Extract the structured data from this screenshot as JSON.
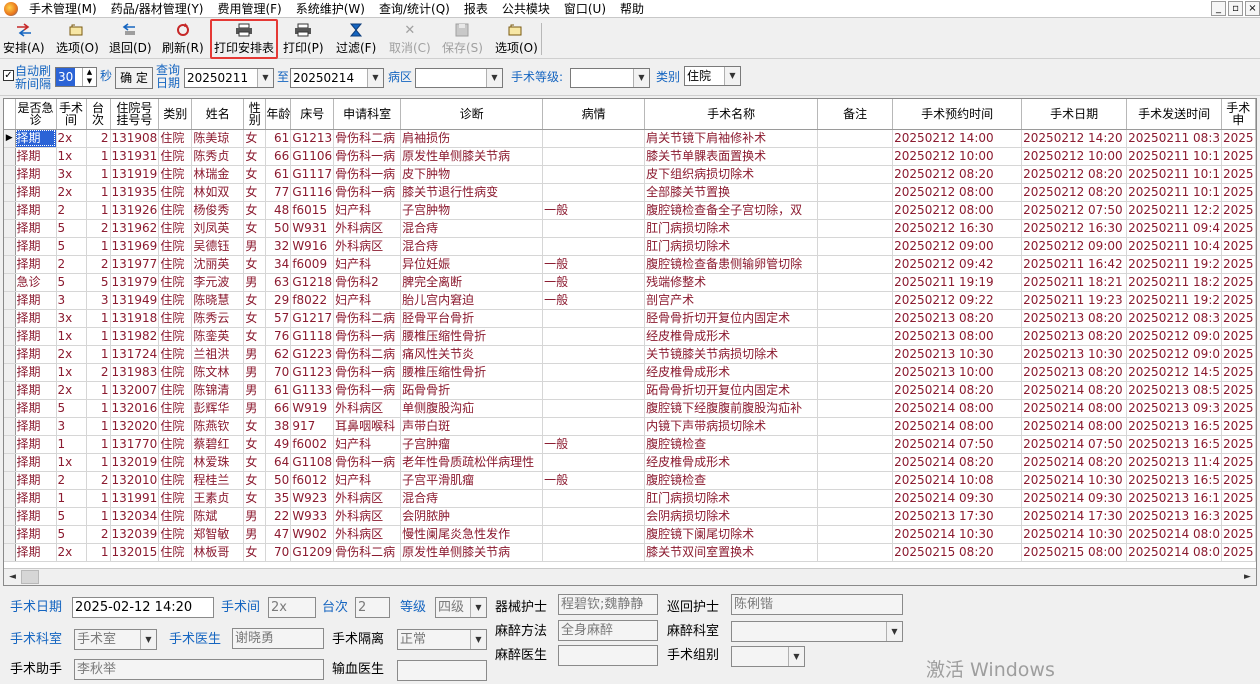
{
  "menubar": {
    "items": [
      "手术管理(M)",
      "药品/器材管理(Y)",
      "费用管理(F)",
      "系统维护(W)",
      "查询/统计(Q)",
      "报表",
      "公共模块",
      "窗口(U)",
      "帮助"
    ],
    "mdi_min": "_",
    "mdi_restore": "▫",
    "mdi_close": "×"
  },
  "toolbar": {
    "arrange": "安排(A)",
    "options1": "选项(O)",
    "return": "退回(D)",
    "refresh": "刷新(R)",
    "print_schedule": "打印安排表",
    "print": "打印(P)",
    "filter": "过滤(F)",
    "cancel": "取消(C)",
    "save": "保存(S)",
    "options2": "选项(O)"
  },
  "filter": {
    "auto_refresh_label_1": "自动刷",
    "auto_refresh_label_2": "新间隔",
    "interval": "30",
    "seconds": "秒",
    "confirm": "确 定",
    "query_date_1": "查询",
    "query_date_2": "日期",
    "date_from": "20250211",
    "to": "至",
    "date_to": "20250214",
    "ward_label": "病区",
    "ward_value": "",
    "level_label": "手术等级:",
    "level_value": "",
    "category_label": "类别",
    "category_value": "住院"
  },
  "grid": {
    "columns": [
      "是否急诊",
      "手术间",
      "台次",
      "住院号挂号号",
      "类别",
      "姓名",
      "性别",
      "年龄",
      "床号",
      "申请科室",
      "诊断",
      "病情",
      "手术名称",
      "备注",
      "手术预约时间",
      "手术日期",
      "手术发送时间",
      "手术申"
    ],
    "rows": [
      [
        "择期",
        "2x",
        "2",
        "131908",
        "住院",
        "陈美琼",
        "女",
        "61",
        "G1213",
        "骨伤科二病",
        "肩袖损伤",
        "",
        "肩关节镜下肩袖修补术",
        "",
        "20250212 14:00",
        "20250212 14:20",
        "20250211 08:3",
        "2025"
      ],
      [
        "择期",
        "1x",
        "1",
        "131931",
        "住院",
        "陈秀贞",
        "女",
        "66",
        "G1106",
        "骨伤科一病",
        "原发性单侧膝关节病",
        "",
        "膝关节单髁表面置换术",
        "",
        "20250212 10:00",
        "20250212 10:00",
        "20250211 10:1",
        "2025"
      ],
      [
        "择期",
        "3x",
        "1",
        "131919",
        "住院",
        "林瑞金",
        "女",
        "61",
        "G1117",
        "骨伤科一病",
        "皮下肿物",
        "",
        "皮下组织病损切除术",
        "",
        "20250212 08:20",
        "20250212 08:20",
        "20250211 10:1",
        "2025"
      ],
      [
        "择期",
        "2x",
        "1",
        "131935",
        "住院",
        "林如双",
        "女",
        "77",
        "G1116",
        "骨伤科一病",
        "膝关节退行性病变",
        "",
        "全部膝关节置换",
        "",
        "20250212 08:00",
        "20250212 08:20",
        "20250211 10:1",
        "2025"
      ],
      [
        "择期",
        "2",
        "1",
        "131926",
        "住院",
        "杨俊秀",
        "女",
        "48",
        "f6015",
        "妇产科",
        "子宫肿物",
        "一般",
        "腹腔镜检查备全子宫切除，双",
        "",
        "20250212 08:00",
        "20250212 07:50",
        "20250211 12:2",
        "2025"
      ],
      [
        "择期",
        "5",
        "2",
        "131962",
        "住院",
        "刘凤英",
        "女",
        "50",
        "W931",
        "外科病区",
        "混合痔",
        "",
        "肛门病损切除术",
        "",
        "20250212 16:30",
        "20250212 16:30",
        "20250211 09:4",
        "2025"
      ],
      [
        "择期",
        "5",
        "1",
        "131969",
        "住院",
        "吴德钰",
        "男",
        "32",
        "W916",
        "外科病区",
        "混合痔",
        "",
        "肛门病损切除术",
        "",
        "20250212 09:00",
        "20250212 09:00",
        "20250211 10:4",
        "2025"
      ],
      [
        "择期",
        "2",
        "2",
        "131977",
        "住院",
        "沈丽英",
        "女",
        "34",
        "f6009",
        "妇产科",
        "异位妊娠",
        "一般",
        "腹腔镜检查备患侧输卵管切除",
        "",
        "20250212 09:42",
        "20250211 16:42",
        "20250211 19:2",
        "2025"
      ],
      [
        "急诊",
        "5",
        "5",
        "131979",
        "住院",
        "李元波",
        "男",
        "63",
        "G1218",
        "骨伤科2",
        "脾完全离断",
        "一般",
        "残端修整术",
        "",
        "20250211 19:19",
        "20250211 18:21",
        "20250211 18:2",
        "2025"
      ],
      [
        "择期",
        "3",
        "3",
        "131949",
        "住院",
        "陈晓慧",
        "女",
        "29",
        "f8022",
        "妇产科",
        "胎儿宫内窘迫",
        "一般",
        "剖宫产术",
        "",
        "20250212 09:22",
        "20250211 19:23",
        "20250211 19:2",
        "2025"
      ],
      [
        "择期",
        "3x",
        "1",
        "131918",
        "住院",
        "陈秀云",
        "女",
        "57",
        "G1217",
        "骨伤科二病",
        "胫骨平台骨折",
        "",
        "胫骨骨折切开复位内固定术",
        "",
        "20250213 08:20",
        "20250213 08:20",
        "20250212 08:3",
        "2025"
      ],
      [
        "择期",
        "1x",
        "1",
        "131982",
        "住院",
        "陈銮英",
        "女",
        "76",
        "G1118",
        "骨伤科一病",
        "腰椎压缩性骨折",
        "",
        "经皮椎骨成形术",
        "",
        "20250213 08:00",
        "20250213 08:20",
        "20250212 09:0",
        "2025"
      ],
      [
        "择期",
        "2x",
        "1",
        "131724",
        "住院",
        "兰祖洪",
        "男",
        "62",
        "G1223",
        "骨伤科二病",
        "痛风性关节炎",
        "",
        "关节镜膝关节病损切除术",
        "",
        "20250213 10:30",
        "20250213 10:30",
        "20250212 09:0",
        "2025"
      ],
      [
        "择期",
        "1x",
        "2",
        "131983",
        "住院",
        "陈文林",
        "男",
        "70",
        "G1123",
        "骨伤科一病",
        "腰椎压缩性骨折",
        "",
        "经皮椎骨成形术",
        "",
        "20250213 10:00",
        "20250213 08:20",
        "20250212 14:5",
        "2025"
      ],
      [
        "择期",
        "2x",
        "1",
        "132007",
        "住院",
        "陈锦清",
        "男",
        "61",
        "G1133",
        "骨伤科一病",
        "跖骨骨折",
        "",
        "跖骨骨折切开复位内固定术",
        "",
        "20250214 08:20",
        "20250214 08:20",
        "20250213 08:5",
        "2025"
      ],
      [
        "择期",
        "5",
        "1",
        "132016",
        "住院",
        "彭辉华",
        "男",
        "66",
        "W919",
        "外科病区",
        "单侧腹股沟疝",
        "",
        "腹腔镜下经腹腹前腹股沟疝补",
        "",
        "20250214 08:00",
        "20250214 08:00",
        "20250213 09:3",
        "2025"
      ],
      [
        "择期",
        "3",
        "1",
        "132020",
        "住院",
        "陈燕钦",
        "女",
        "38",
        "917",
        "耳鼻咽喉科",
        "声带白斑",
        "",
        "内镜下声带病损切除术",
        "",
        "20250214 08:00",
        "20250214 08:00",
        "20250213 16:5",
        "2025"
      ],
      [
        "择期",
        "1",
        "1",
        "131770",
        "住院",
        "蔡碧红",
        "女",
        "49",
        "f6002",
        "妇产科",
        "子宫肿瘤",
        "一般",
        "腹腔镜检查",
        "",
        "20250214 07:50",
        "20250214 07:50",
        "20250213 16:5",
        "2025"
      ],
      [
        "择期",
        "1x",
        "1",
        "132019",
        "住院",
        "林爱珠",
        "女",
        "64",
        "G1108",
        "骨伤科一病",
        "老年性骨质疏松伴病理性",
        "",
        "经皮椎骨成形术",
        "",
        "20250214 08:20",
        "20250214 08:20",
        "20250213 11:4",
        "2025"
      ],
      [
        "择期",
        "2",
        "2",
        "132010",
        "住院",
        "程桂兰",
        "女",
        "50",
        "f6012",
        "妇产科",
        "子宫平滑肌瘤",
        "一般",
        "腹腔镜检查",
        "",
        "20250214 10:08",
        "20250214 10:30",
        "20250213 16:5",
        "2025"
      ],
      [
        "择期",
        "1",
        "1",
        "131991",
        "住院",
        "王素贞",
        "女",
        "35",
        "W923",
        "外科病区",
        "混合痔",
        "",
        "肛门病损切除术",
        "",
        "20250214 09:30",
        "20250214 09:30",
        "20250213 16:1",
        "2025"
      ],
      [
        "择期",
        "5",
        "1",
        "132034",
        "住院",
        "陈斌",
        "男",
        "22",
        "W933",
        "外科病区",
        "会阴脓肿",
        "",
        "会阴病损切除术",
        "",
        "20250213 17:30",
        "20250214 17:30",
        "20250213 16:3",
        "2025"
      ],
      [
        "择期",
        "5",
        "2",
        "132039",
        "住院",
        "郑智敏",
        "男",
        "47",
        "W902",
        "外科病区",
        "慢性阑尾炎急性发作",
        "",
        "腹腔镜下阑尾切除术",
        "",
        "20250214 10:30",
        "20250214 10:30",
        "20250214 08:0",
        "2025"
      ],
      [
        "择期",
        "2x",
        "1",
        "132015",
        "住院",
        "林板哥",
        "女",
        "70",
        "G1209",
        "骨伤科二病",
        "原发性单侧膝关节病",
        "",
        "膝关节双间室置换术",
        "",
        "20250215 08:20",
        "20250215 08:00",
        "20250214 08:0",
        "2025"
      ]
    ],
    "scroll_left": "◄",
    "scroll_right": "►"
  },
  "detail": {
    "op_date_label": "手术日期",
    "op_date_value": "2025-02-12 14:20",
    "op_room_label": "手术间",
    "op_room_value": "2x",
    "sequence_label": "台次",
    "sequence_value": "2",
    "level_label": "等级",
    "level_value": "四级",
    "instrument_nurse_label": "器械护士",
    "instrument_nurse_value": "程碧钦;魏静静",
    "circulating_nurse_label": "巡回护士",
    "circulating_nurse_value": "陈俐锴",
    "op_dept_label": "手术科室",
    "op_dept_value": "手术室",
    "surgeon_label": "手术医生",
    "surgeon_value": "谢晓勇",
    "isolation_label": "手术隔离",
    "isolation_value": "正常",
    "anesthesia_method_label": "麻醉方法",
    "anesthesia_method_value": "全身麻醉",
    "anesthesia_dept_label": "麻醉科室",
    "anesthesia_dept_value": "",
    "assistant_label": "手术助手",
    "assistant_value": "李秋举",
    "transfusion_doctor_label": "输血医生",
    "transfusion_doctor_value": "",
    "anesthesiologist_label": "麻醉医生",
    "anesthesiologist_value": "",
    "op_group_label": "手术组别",
    "op_group_value": ""
  },
  "watermark": "激活 Windows",
  "colors": {
    "row_text": "#8b1a2f",
    "label_blue": "#1565c0",
    "selection": "#2b63d6",
    "highlight_border": "#e53935"
  }
}
